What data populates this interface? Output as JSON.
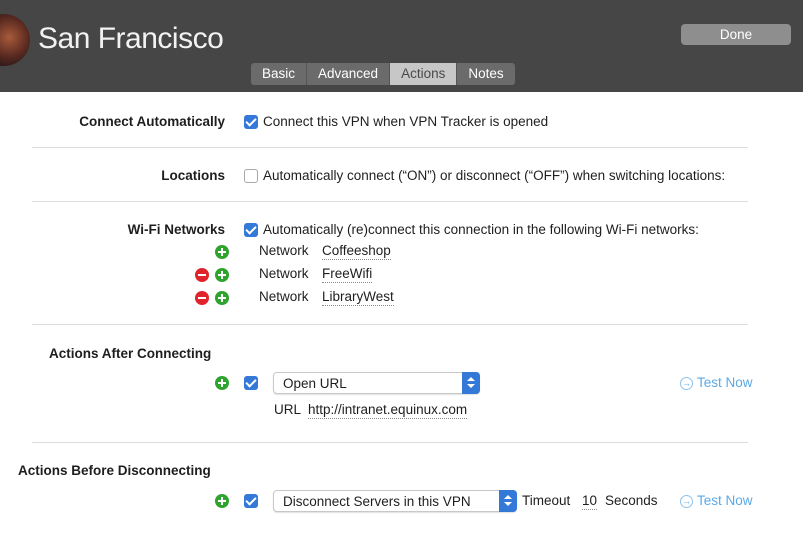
{
  "header": {
    "title": "San Francisco",
    "done_label": "Done",
    "tabs": [
      {
        "label": "Basic",
        "active": false
      },
      {
        "label": "Advanced",
        "active": false
      },
      {
        "label": "Actions",
        "active": true
      },
      {
        "label": "Notes",
        "active": false
      }
    ]
  },
  "connect_automatically": {
    "label": "Connect Automatically",
    "checkbox_text": "Connect this VPN when VPN Tracker is opened",
    "checked": true
  },
  "locations": {
    "label": "Locations",
    "checkbox_text": "Automatically connect (“ON”) or disconnect (“OFF”) when switching locations:",
    "checked": false
  },
  "wifi": {
    "label": "Wi-Fi Networks",
    "checkbox_text": "Automatically (re)connect this connection in the following Wi-Fi networks:",
    "checked": true,
    "network_label": "Network",
    "networks": [
      "Coffeeshop",
      "FreeWifi",
      "LibraryWest"
    ]
  },
  "after_connecting": {
    "label": "Actions After Connecting",
    "action": "Open URL",
    "url_label": "URL",
    "url_value": "http://intranet.equinux.com",
    "test_now": "Test Now"
  },
  "before_disconnecting": {
    "label": "Actions Before Disconnecting",
    "action": "Disconnect Servers in this VPN",
    "timeout_label": "Timeout",
    "timeout_value": "10",
    "seconds_label": "Seconds",
    "test_now": "Test Now"
  },
  "colors": {
    "header_bg": "#464646",
    "accent_blue": "#3478d8",
    "add_green": "#2ea32e",
    "remove_red": "#e0242b",
    "link_blue": "#5aa9e6"
  },
  "icons": [
    "avatar",
    "checkbox-icon",
    "add-icon",
    "remove-icon",
    "popup-arrows-icon",
    "arrow-right-circle-icon"
  ]
}
